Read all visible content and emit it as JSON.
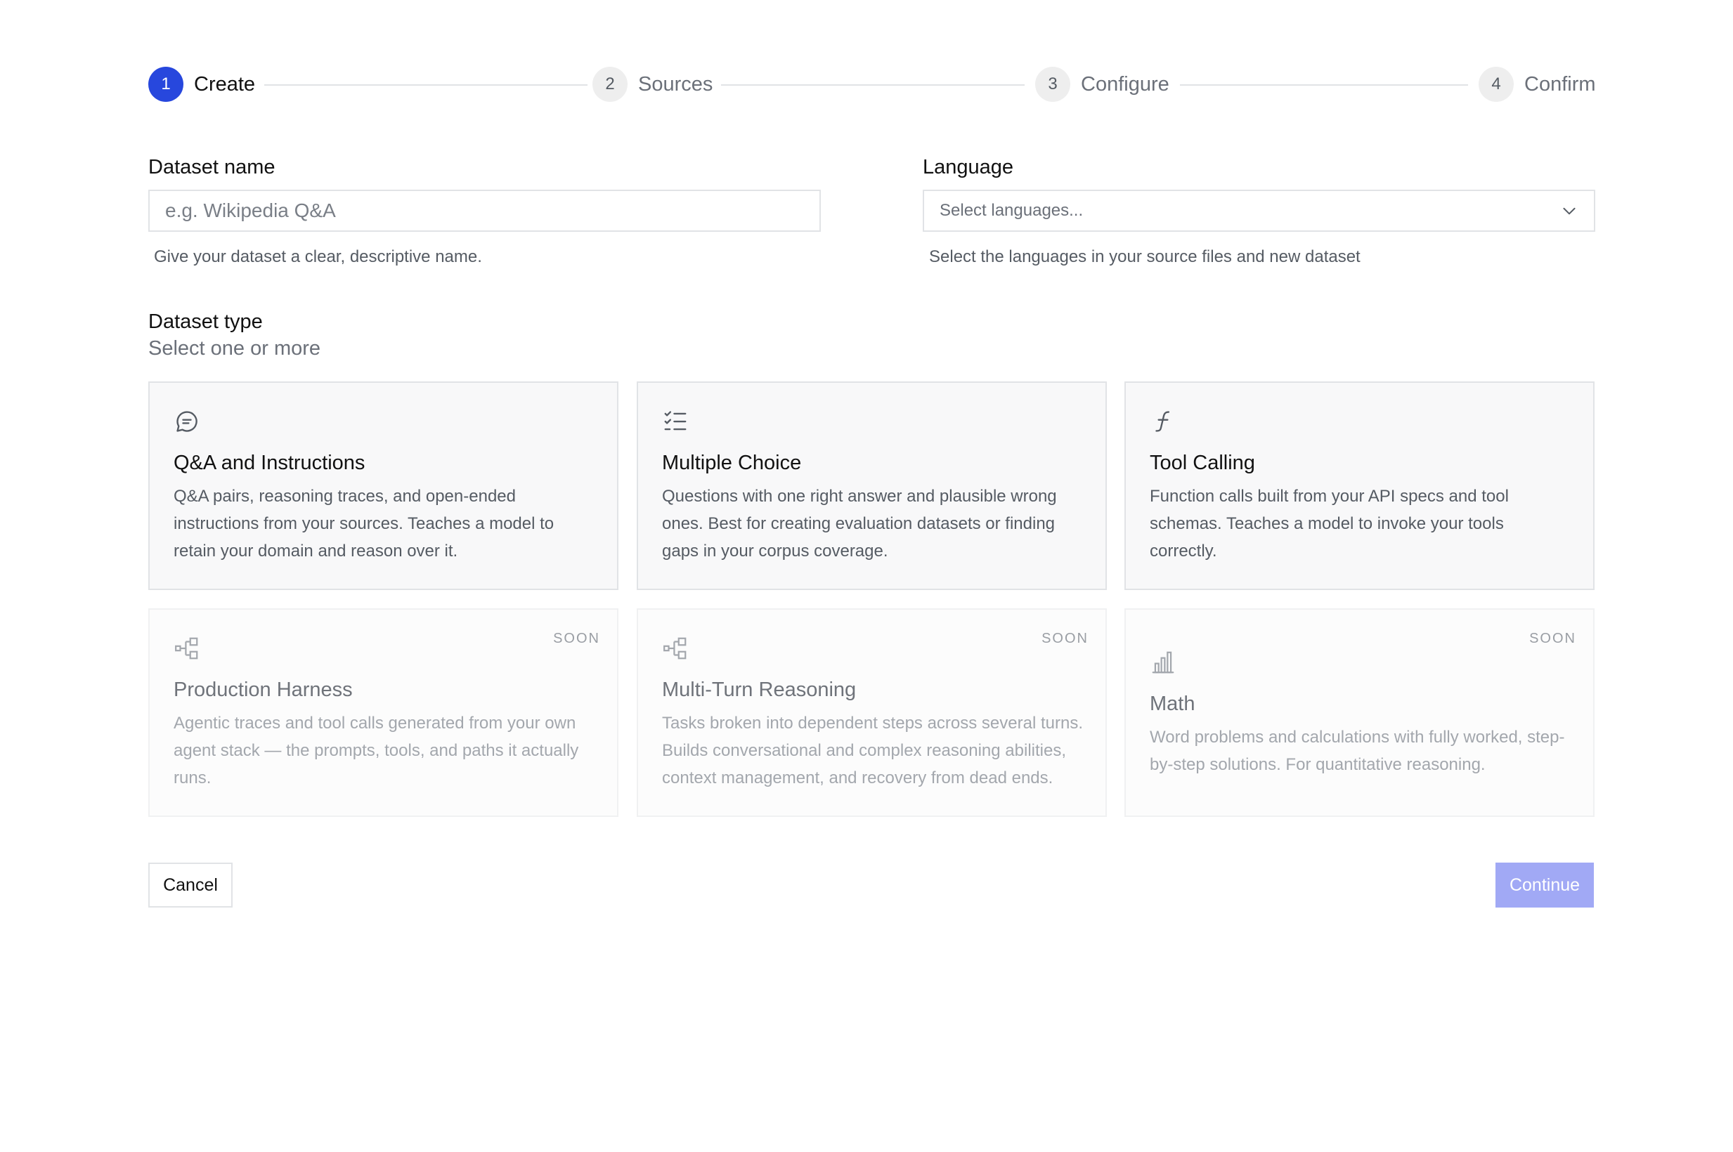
{
  "stepper": {
    "steps": [
      {
        "number": "1",
        "label": "Create",
        "active": true
      },
      {
        "number": "2",
        "label": "Sources",
        "active": false
      },
      {
        "number": "3",
        "label": "Configure",
        "active": false
      },
      {
        "number": "4",
        "label": "Confirm",
        "active": false
      }
    ]
  },
  "form": {
    "dataset_name": {
      "label": "Dataset name",
      "value": "",
      "placeholder": "e.g. Wikipedia Q&A",
      "help": "Give your dataset a clear, descriptive name."
    },
    "language": {
      "label": "Language",
      "placeholder": "Select languages...",
      "help": "Select the languages in your source files and new dataset",
      "icon": "chevron-down-icon"
    }
  },
  "dataset_type": {
    "title": "Dataset type",
    "subtitle": "Select one or more",
    "cards": [
      {
        "title": "Q&A and Instructions",
        "description": "Q&A pairs, reasoning traces, and open-ended instructions from your sources. Teaches a model to retain your domain and reason over it.",
        "icon": "chat-bubble-icon",
        "badge": "",
        "disabled": false
      },
      {
        "title": "Multiple Choice",
        "description": "Questions with one right answer and plausible wrong ones. Best for creating evaluation datasets or finding gaps in your corpus coverage.",
        "icon": "checklist-icon",
        "badge": "",
        "disabled": false
      },
      {
        "title": "Tool Calling",
        "description": "Function calls built from your API specs and tool schemas. Teaches a model to invoke your tools correctly.",
        "icon": "function-icon",
        "badge": "",
        "disabled": false
      },
      {
        "title": "Production Harness",
        "description": "Agentic traces and tool calls generated from your own agent stack — the prompts, tools, and paths it actually runs.",
        "icon": "flow-tree-icon",
        "badge": "SOON",
        "disabled": true
      },
      {
        "title": "Multi-Turn Reasoning",
        "description": "Tasks broken into dependent steps across several turns. Builds conversational and complex reasoning abilities, context management, and recovery from dead ends.",
        "icon": "flow-tree-icon",
        "badge": "SOON",
        "disabled": true
      },
      {
        "title": "Math",
        "description": "Word problems and calculations with fully worked, step-by-step solutions. For quantitative reasoning.",
        "icon": "bar-chart-icon",
        "badge": "SOON",
        "disabled": true
      }
    ]
  },
  "actions": {
    "cancel_label": "Cancel",
    "continue_label": "Continue"
  },
  "colors": {
    "accent": "#2747dd",
    "continue_disabled": "#a1a9f5",
    "border": "#e1e3e6",
    "card_bg": "#f8f8f9"
  }
}
